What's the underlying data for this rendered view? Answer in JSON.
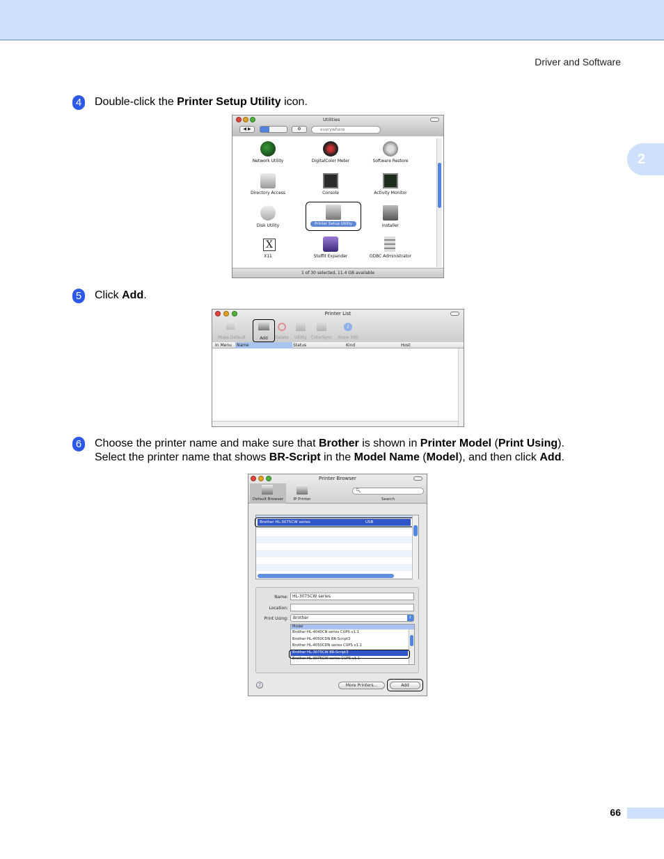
{
  "header": {
    "section_title": "Driver and Software",
    "chapter_tab": "2"
  },
  "steps": [
    {
      "number": "4",
      "parts": [
        "Double-click the ",
        "Printer Setup Utility",
        " icon."
      ]
    },
    {
      "number": "5",
      "parts": [
        "Click ",
        "Add",
        "."
      ]
    },
    {
      "number": "6",
      "line1": [
        "Choose the printer name and make sure that ",
        "Brother",
        " is shown in ",
        "Printer Model",
        " (",
        "Print Using",
        ")."
      ],
      "line2": [
        "Select the printer name that shows ",
        "BR-Script",
        " in the ",
        "Model Name",
        " (",
        "Model",
        "), and then click ",
        "Add",
        "."
      ]
    }
  ],
  "screenshot1": {
    "title": "Utilities",
    "search_placeholder": "everywhere",
    "items": [
      "Network Utility",
      "DigitalColor Meter",
      "Software Restore",
      "Directory Access",
      "Console",
      "Activity Monitor",
      "Disk Utility",
      "Printer Setup Utility",
      "Installer",
      "X11",
      "StuffIt Expander",
      "ODBC Administrator"
    ],
    "status": "1 of 30 selected, 11.4 GB available"
  },
  "screenshot2": {
    "title": "Printer List",
    "toolbar": [
      "Make Default",
      "Add",
      "Delete",
      "Utility",
      "ColorSync",
      "Show Info"
    ],
    "columns": [
      "In Menu",
      "Name",
      "Status",
      "Kind",
      "Host"
    ]
  },
  "screenshot3": {
    "title": "Printer Browser",
    "toolbar": [
      "Default Browser",
      "IP Printer"
    ],
    "search_label": "Search",
    "selected_printer": "Brother HL-3075CW series",
    "connection": "USB",
    "name_label": "Name:",
    "name_value": "HL-3075CW series",
    "location_label": "Location:",
    "print_using_label": "Print Using:",
    "print_using_value": "Brother",
    "model_header": "Model",
    "models": [
      "Brother HL-4040CN series CUPS v1.1",
      "Brother HL-4050CDN BR-Script3",
      "Brother HL-4050CDN series CUPS v1.1",
      "Brother HL-3075CW BR-Script3",
      "Brother HL-3075CW series CUPS v1.1"
    ],
    "more_printers_button": "More Printers...",
    "add_button": "Add"
  },
  "footer": {
    "page_number": "66"
  }
}
